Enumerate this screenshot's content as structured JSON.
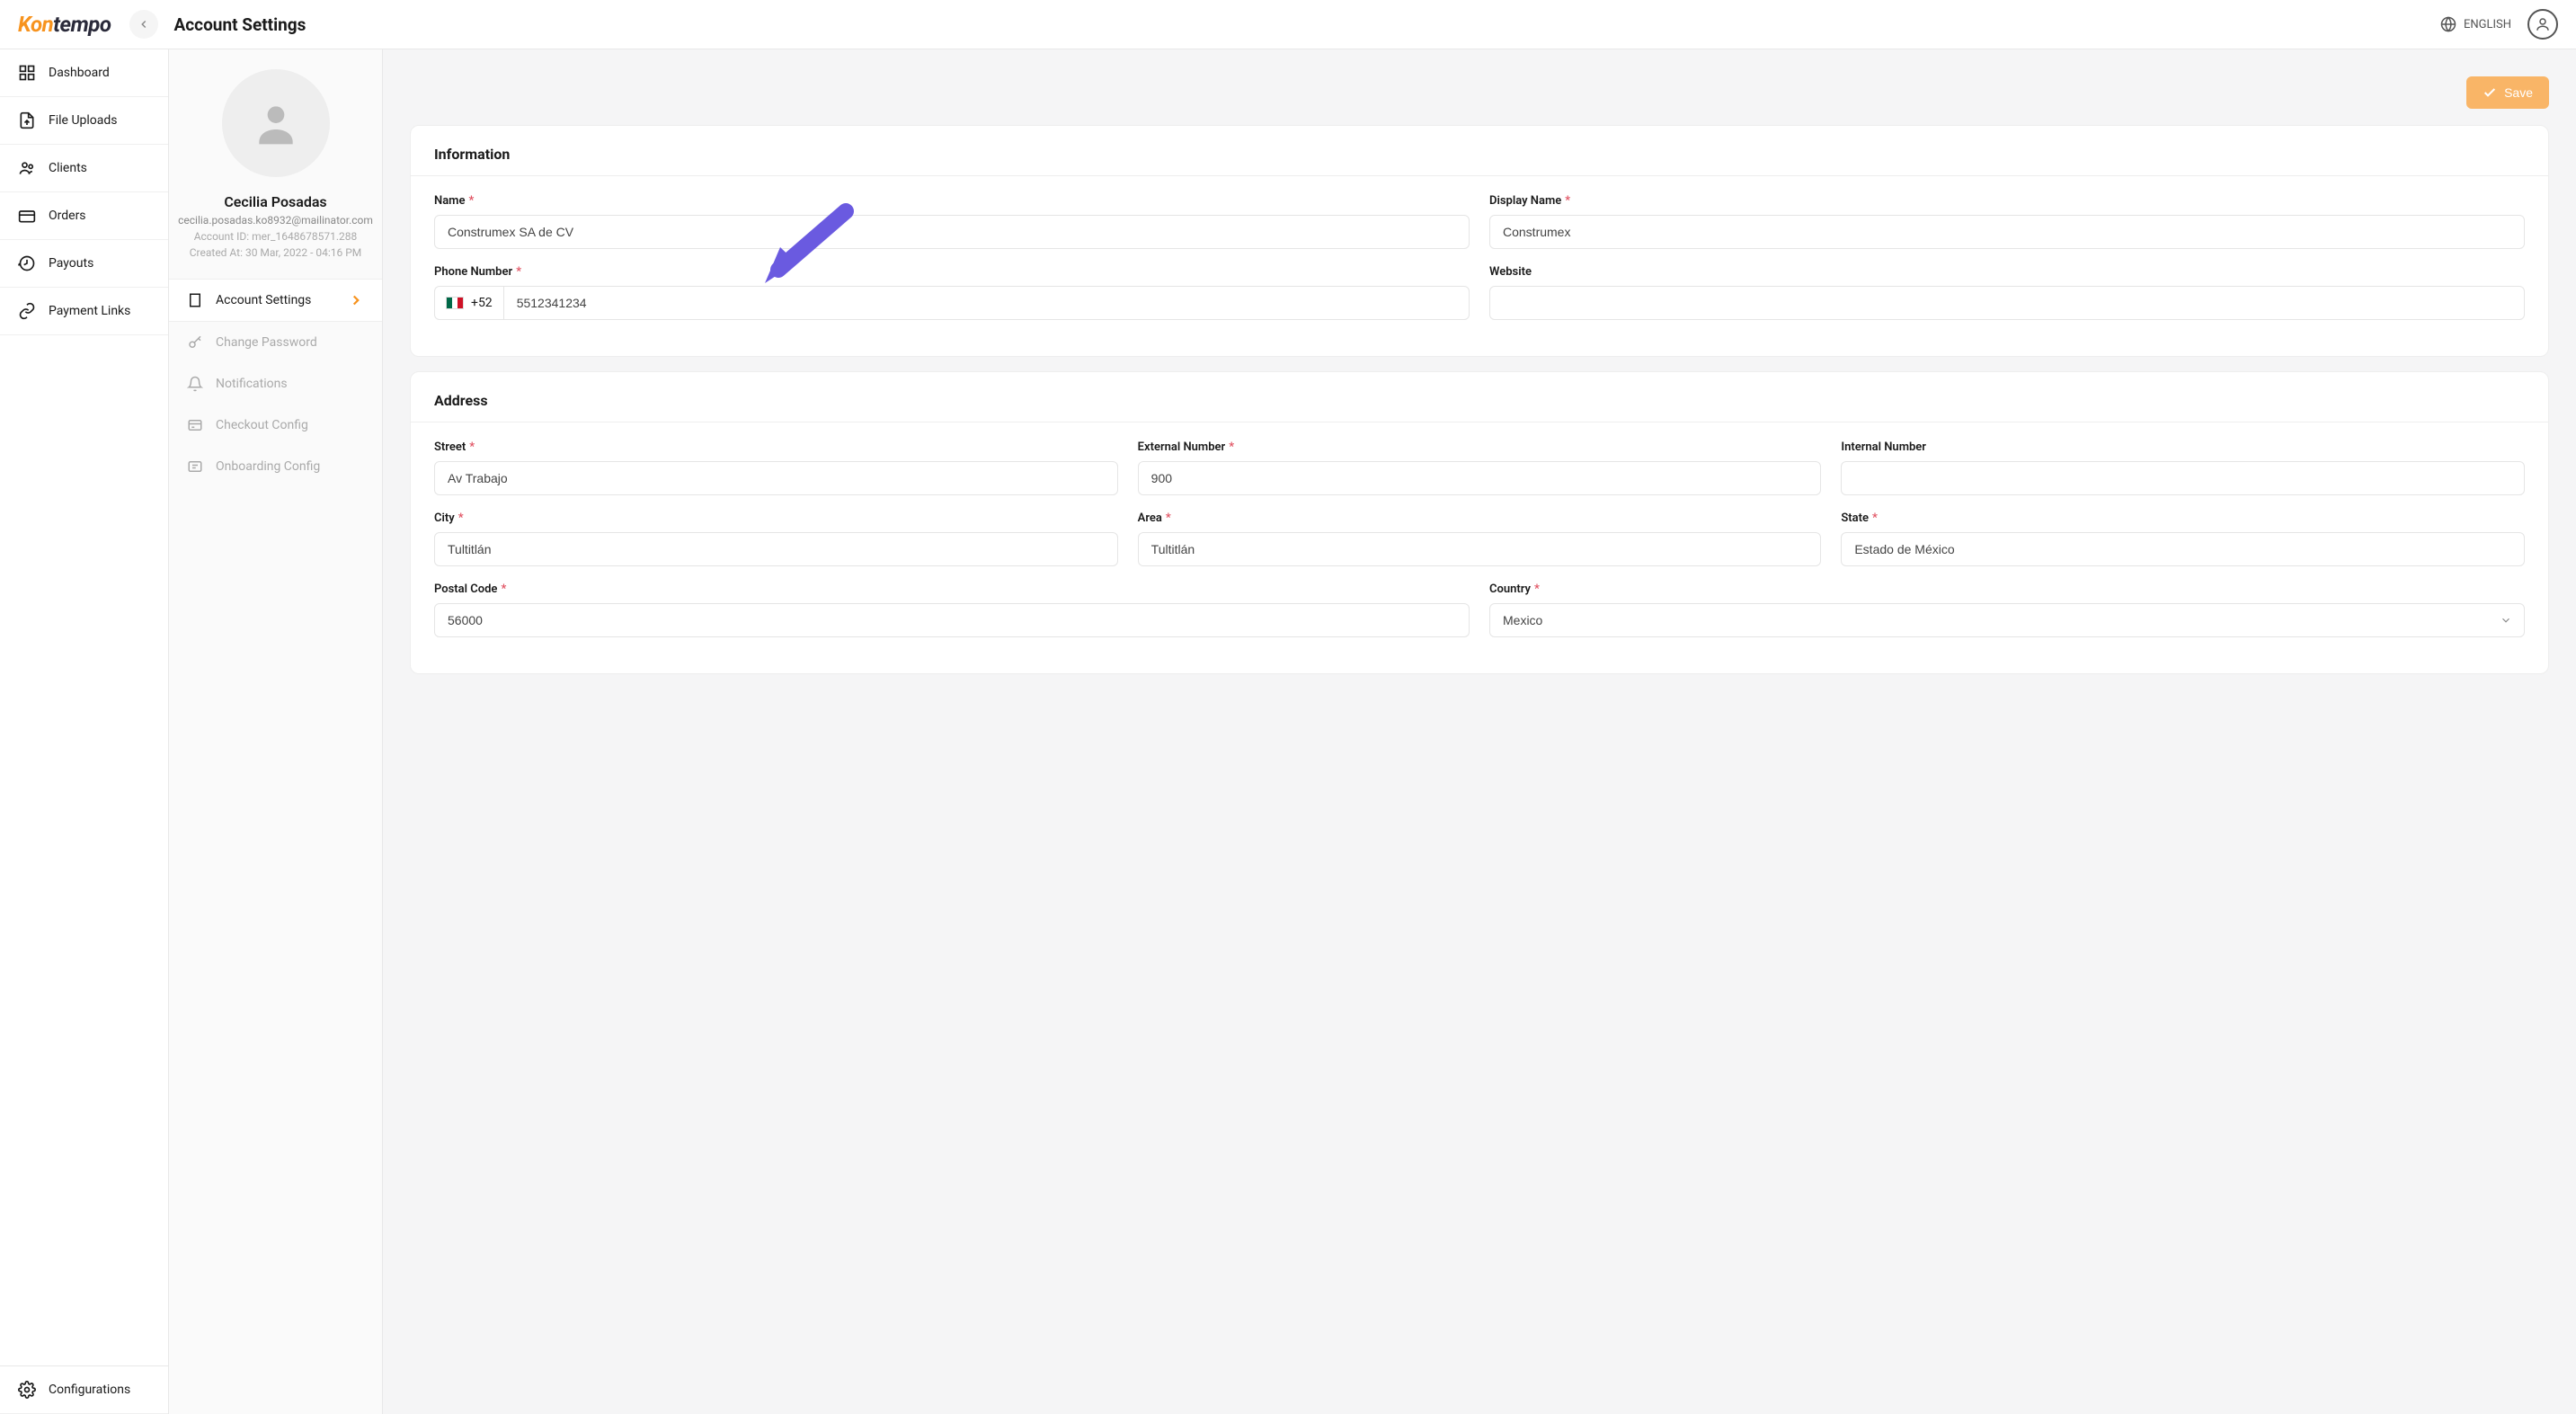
{
  "header": {
    "logo_a": "Kon",
    "logo_b": "tempo",
    "page_title": "Account Settings",
    "language": "ENGLISH"
  },
  "sidebar": {
    "items": [
      {
        "label": "Dashboard"
      },
      {
        "label": "File Uploads"
      },
      {
        "label": "Clients"
      },
      {
        "label": "Orders"
      },
      {
        "label": "Payouts"
      },
      {
        "label": "Payment Links"
      }
    ],
    "bottom": {
      "label": "Configurations"
    }
  },
  "profile": {
    "name": "Cecilia Posadas",
    "email": "cecilia.posadas.ko8932@mailinator.com",
    "account_id": "Account ID: mer_1648678571.288",
    "created_at": "Created At: 30 Mar, 2022 - 04:16 PM"
  },
  "subnav": {
    "items": [
      {
        "label": "Account Settings",
        "active": true
      },
      {
        "label": "Change Password"
      },
      {
        "label": "Notifications"
      },
      {
        "label": "Checkout Config"
      },
      {
        "label": "Onboarding Config"
      }
    ]
  },
  "actions": {
    "save": "Save"
  },
  "info_section": {
    "title": "Information",
    "name_label": "Name",
    "name_value": "Construmex SA de CV",
    "display_name_label": "Display Name",
    "display_name_value": "Construmex",
    "phone_label": "Phone Number",
    "phone_prefix": "+52",
    "phone_value": "5512341234",
    "website_label": "Website",
    "website_value": ""
  },
  "address_section": {
    "title": "Address",
    "street_label": "Street",
    "street_value": "Av Trabajo",
    "ext_label": "External Number",
    "ext_value": "900",
    "int_label": "Internal Number",
    "int_value": "",
    "city_label": "City",
    "city_value": "Tultitlán",
    "area_label": "Area",
    "area_value": "Tultitlán",
    "state_label": "State",
    "state_value": "Estado de México",
    "postal_label": "Postal Code",
    "postal_value": "56000",
    "country_label": "Country",
    "country_value": "Mexico"
  }
}
